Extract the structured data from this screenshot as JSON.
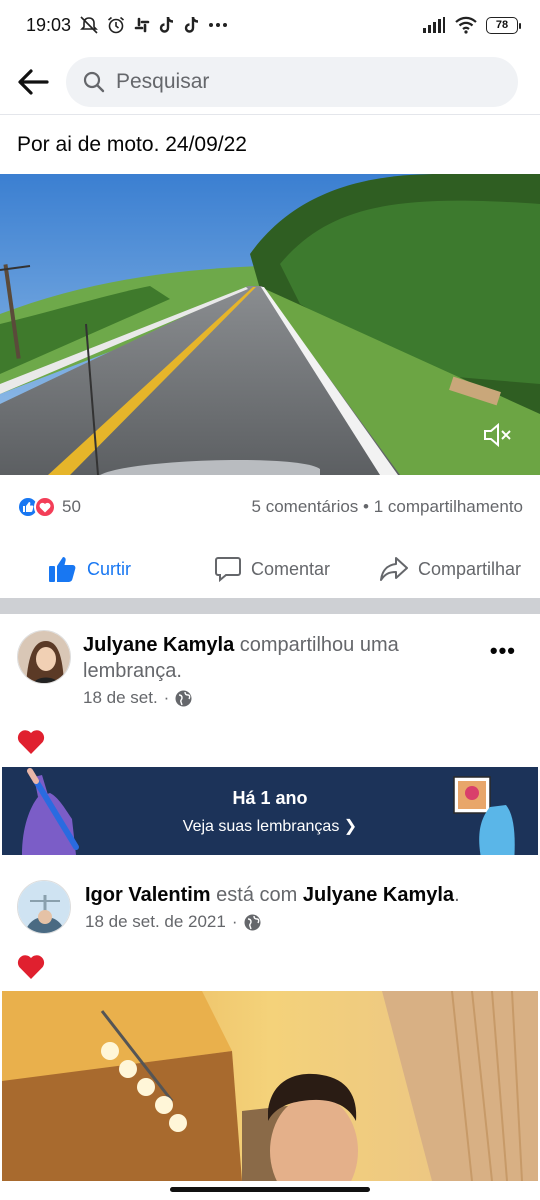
{
  "status_bar": {
    "time": "19:03",
    "icons_left": [
      "muted-notification-icon",
      "alarm-icon",
      "slack-icon",
      "tiktok-icon",
      "tiktok-icon",
      "more-dots-icon"
    ],
    "icons_right": [
      "signal-icon",
      "wifi-icon"
    ],
    "battery": "78"
  },
  "search": {
    "placeholder": "Pesquisar"
  },
  "post1": {
    "caption": "Por ai de moto. 24/09/22",
    "reaction_count": "50",
    "stats": "5 comentários • 1 compartilhamento",
    "actions": {
      "like": "Curtir",
      "comment": "Comentar",
      "share": "Compartilhar"
    }
  },
  "post2": {
    "author": "Julyane Kamyla",
    "action_text": " compartilhou uma lembrança.",
    "date": "18 de set.",
    "sep": "·",
    "body_emoji": "heart"
  },
  "memories": {
    "title": "Há 1 ano",
    "subtitle": "Veja suas lembranças"
  },
  "post3": {
    "author": "Igor Valentim",
    "with_text": " está com ",
    "tagged": "Julyane Kamyla",
    "end": ".",
    "date": "18 de set. de 2021",
    "sep": "·",
    "body_emoji": "heart"
  },
  "colors": {
    "brand": "#1877f2",
    "love": "#f33e58",
    "banner": "#1c3359",
    "muted_text": "#65676b"
  }
}
